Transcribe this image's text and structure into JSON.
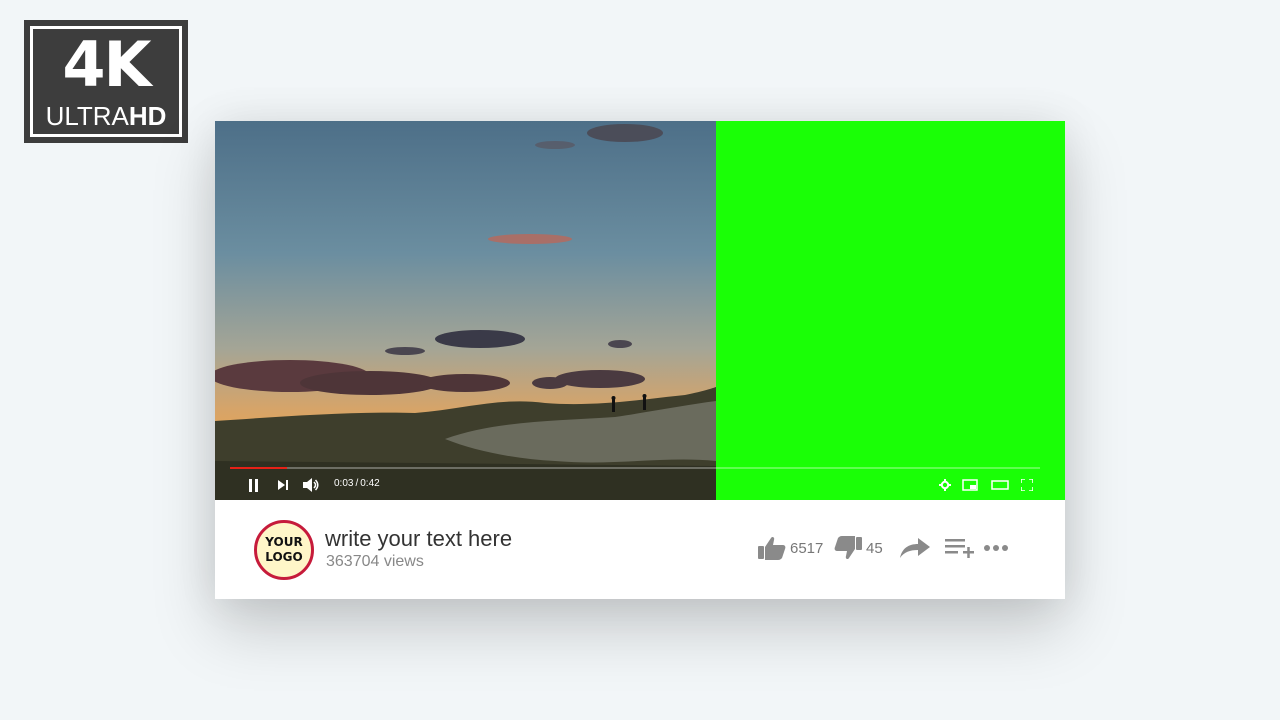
{
  "badge": {
    "main": "4K",
    "sub_left": "ULTRA",
    "sub_right": "HD"
  },
  "player": {
    "current_time": "0:03",
    "time_separator": "/",
    "duration": "0:42",
    "progress_fraction": 0.07,
    "accent_color": "#e62117",
    "greenscreen_color": "#1aff06",
    "controls": [
      "pause-icon",
      "next-icon",
      "volume-icon",
      "settings-icon",
      "miniplayer-icon",
      "theater-icon",
      "fullscreen-icon"
    ]
  },
  "channel": {
    "logo_line1": "YOUR",
    "logo_line2": "LOGO"
  },
  "video": {
    "title": "write your text here",
    "views": "363704 views"
  },
  "actions": {
    "likes": "6517",
    "dislikes": "45",
    "icons": [
      "thumbs-up-icon",
      "thumbs-down-icon",
      "share-icon",
      "add-to-playlist-icon",
      "more-icon"
    ]
  }
}
